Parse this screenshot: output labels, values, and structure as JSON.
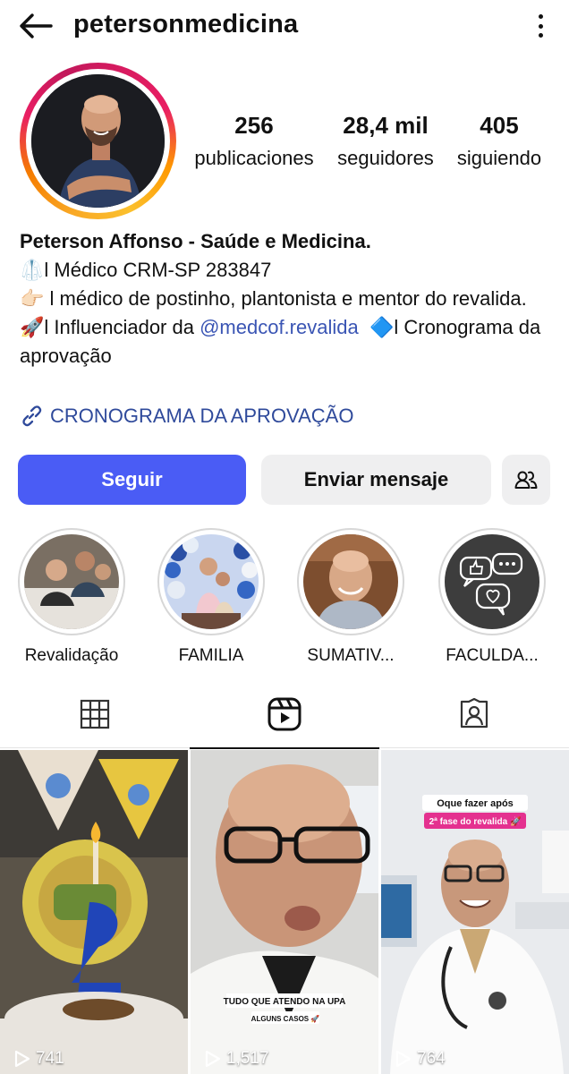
{
  "header": {
    "username": "petersonmedicina",
    "back_icon": "arrow-left-icon",
    "more_icon": "more-vertical-icon"
  },
  "stats": {
    "posts": {
      "value": "256",
      "label": "publicaciones"
    },
    "followers": {
      "value": "28,4 mil",
      "label": "seguidores"
    },
    "following": {
      "value": "405",
      "label": "siguiendo"
    }
  },
  "bio": {
    "name": "Peterson Affonso - Saúde e Medicina.",
    "line1_emoji": "🥼",
    "line1": "l Médico CRM-SP 283847",
    "line2_emoji": "👉🏻",
    "line2": " l médico de postinho, plantonista e mentor do revalida.",
    "line3_emoji": "🚀",
    "line3_pre": "l Influenciador da ",
    "mention": "@medcof.revalida",
    "line3_emoji2": "🔷",
    "line3_post": "l Cronograma da aprovação",
    "link": "CRONOGRAMA DA APROVAÇÃO"
  },
  "actions": {
    "follow": "Seguir",
    "message": "Enviar mensaje",
    "suggest_icon": "add-person-icon"
  },
  "highlights": [
    {
      "label": "Revalidação"
    },
    {
      "label": "FAMILIA"
    },
    {
      "label": "SUMATIV..."
    },
    {
      "label": "FACULDA..."
    }
  ],
  "tabs": [
    {
      "name": "grid",
      "icon": "grid-icon",
      "active": false
    },
    {
      "name": "reels",
      "icon": "reels-icon",
      "active": true
    },
    {
      "name": "tagged",
      "icon": "tagged-icon",
      "active": false
    }
  ],
  "reels": [
    {
      "views": "741"
    },
    {
      "views": "1,517",
      "caption": "TUDO QUE ATENDO NA UPA",
      "subcaption": "ALGUNS CASOS 🚀"
    },
    {
      "views": "764",
      "caption": "Oque fazer após",
      "subcaption": "2ª fase do revalida 🚀"
    }
  ],
  "colors": {
    "follow_button": "#4a5cf5",
    "link": "#2f4a9b",
    "mention": "#3a55b4"
  }
}
